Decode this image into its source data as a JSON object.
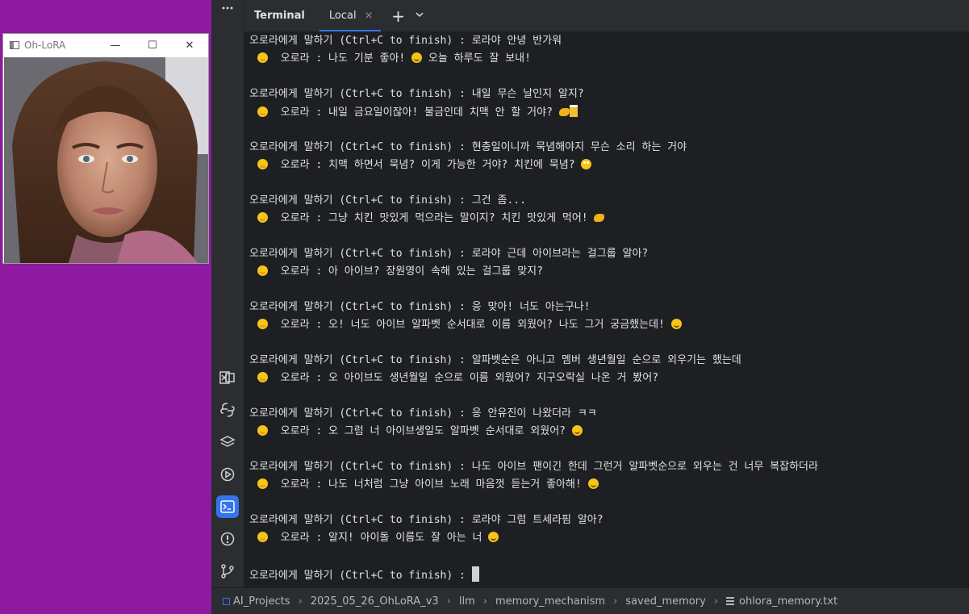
{
  "window": {
    "title": "Oh-LoRA",
    "controls": [
      "—",
      "☐",
      "✕"
    ]
  },
  "ide": {
    "tab_title": "Terminal",
    "tab_local": "Local",
    "tab_close": "×",
    "tab_plus": "+",
    "tab_chevron": "⌄"
  },
  "terminal": {
    "prompt": "오로라에게 말하기 (Ctrl+C to finish) : ",
    "responder": "  오로라 : ",
    "exchanges": [
      {
        "user": "로라야 안녕 반가워",
        "reply": "나도 기분 좋아! ",
        "reply_tail": " 오늘 하루도 잘 보내!",
        "emoji": [
          "smile"
        ]
      },
      {
        "user": "내일 무슨 날인지 알지?",
        "reply": "내일 금요일이잖아! 불금인데 치맥 안 할 거야? ",
        "reply_tail": "",
        "emoji": [
          "hand",
          "beer"
        ]
      },
      {
        "user": "현충일이니까 묵념해야지 무슨 소리 하는 거야",
        "reply": "치맥 하면서 묵념? 이게 가능한 거야? 치킨에 묵념? ",
        "reply_tail": "",
        "emoji": [
          "roll"
        ]
      },
      {
        "user": "그건 좀...",
        "reply": "그냥 치킨 맛있게 먹으라는 말이지? 치킨 맛있게 먹어! ",
        "reply_tail": "",
        "emoji": [
          "hand"
        ]
      },
      {
        "user": "로라야 근데 아이브라는 걸그룹 알아?",
        "reply": "아 아이브? 장원영이 속해 있는 걸그룹 맞지?",
        "reply_tail": "",
        "emoji": []
      },
      {
        "user": "응 맞아! 너도 아는구나!",
        "reply": "오! 너도 아이브 알파벳 순서대로 이름 외웠어? 나도 그거 궁금했는데! ",
        "reply_tail": "",
        "emoji": [
          "smile"
        ]
      },
      {
        "user": "알파벳순은 아니고 멤버 생년월일 순으로 외우기는 했는데",
        "reply": "오 아이브도 생년월일 순으로 이름 외웠어? 지구오락실 나온 거 봤어?",
        "reply_tail": "",
        "emoji": []
      },
      {
        "user": "응 안유진이 나왔더라 ㅋㅋ",
        "reply": "오 그럼 너 아이브생일도 알파벳 순서대로 외웠어? ",
        "reply_tail": "",
        "emoji": [
          "smile"
        ]
      },
      {
        "user": "나도 아이브 팬이긴 한데 그런거 알파벳순으로 외우는 건 너무 복잡하더라",
        "reply": "나도 너처럼 그냥 아이브 노래 마음껏 듣는거 좋아해! ",
        "reply_tail": "",
        "emoji": [
          "smile"
        ]
      },
      {
        "user": "로라야 그럼 트세라핌 알아?",
        "reply": "알지! 아이돌 이름도 잘 아는 너 ",
        "reply_tail": "",
        "emoji": [
          "smile"
        ]
      }
    ],
    "final_prompt": "오로라에게 말하기 (Ctrl+C to finish) : "
  },
  "status_bar": {
    "breadcrumbs": [
      "AI_Projects",
      "2025_05_26_OhLoRA_v3",
      "llm",
      "memory_mechanism",
      "saved_memory",
      "ohlora_memory.txt"
    ],
    "separator": "›"
  },
  "toolbar_icons": [
    "excel-icon",
    "python-icon",
    "layers-icon",
    "run-icon",
    "terminal-icon",
    "problems-icon",
    "git-icon"
  ],
  "colors": {
    "desktop": "#8e1aa2",
    "ide_bg": "#1e1f22",
    "panel_bg": "#2b2d30",
    "accent": "#3574f0",
    "text": "#dfe1e5"
  }
}
